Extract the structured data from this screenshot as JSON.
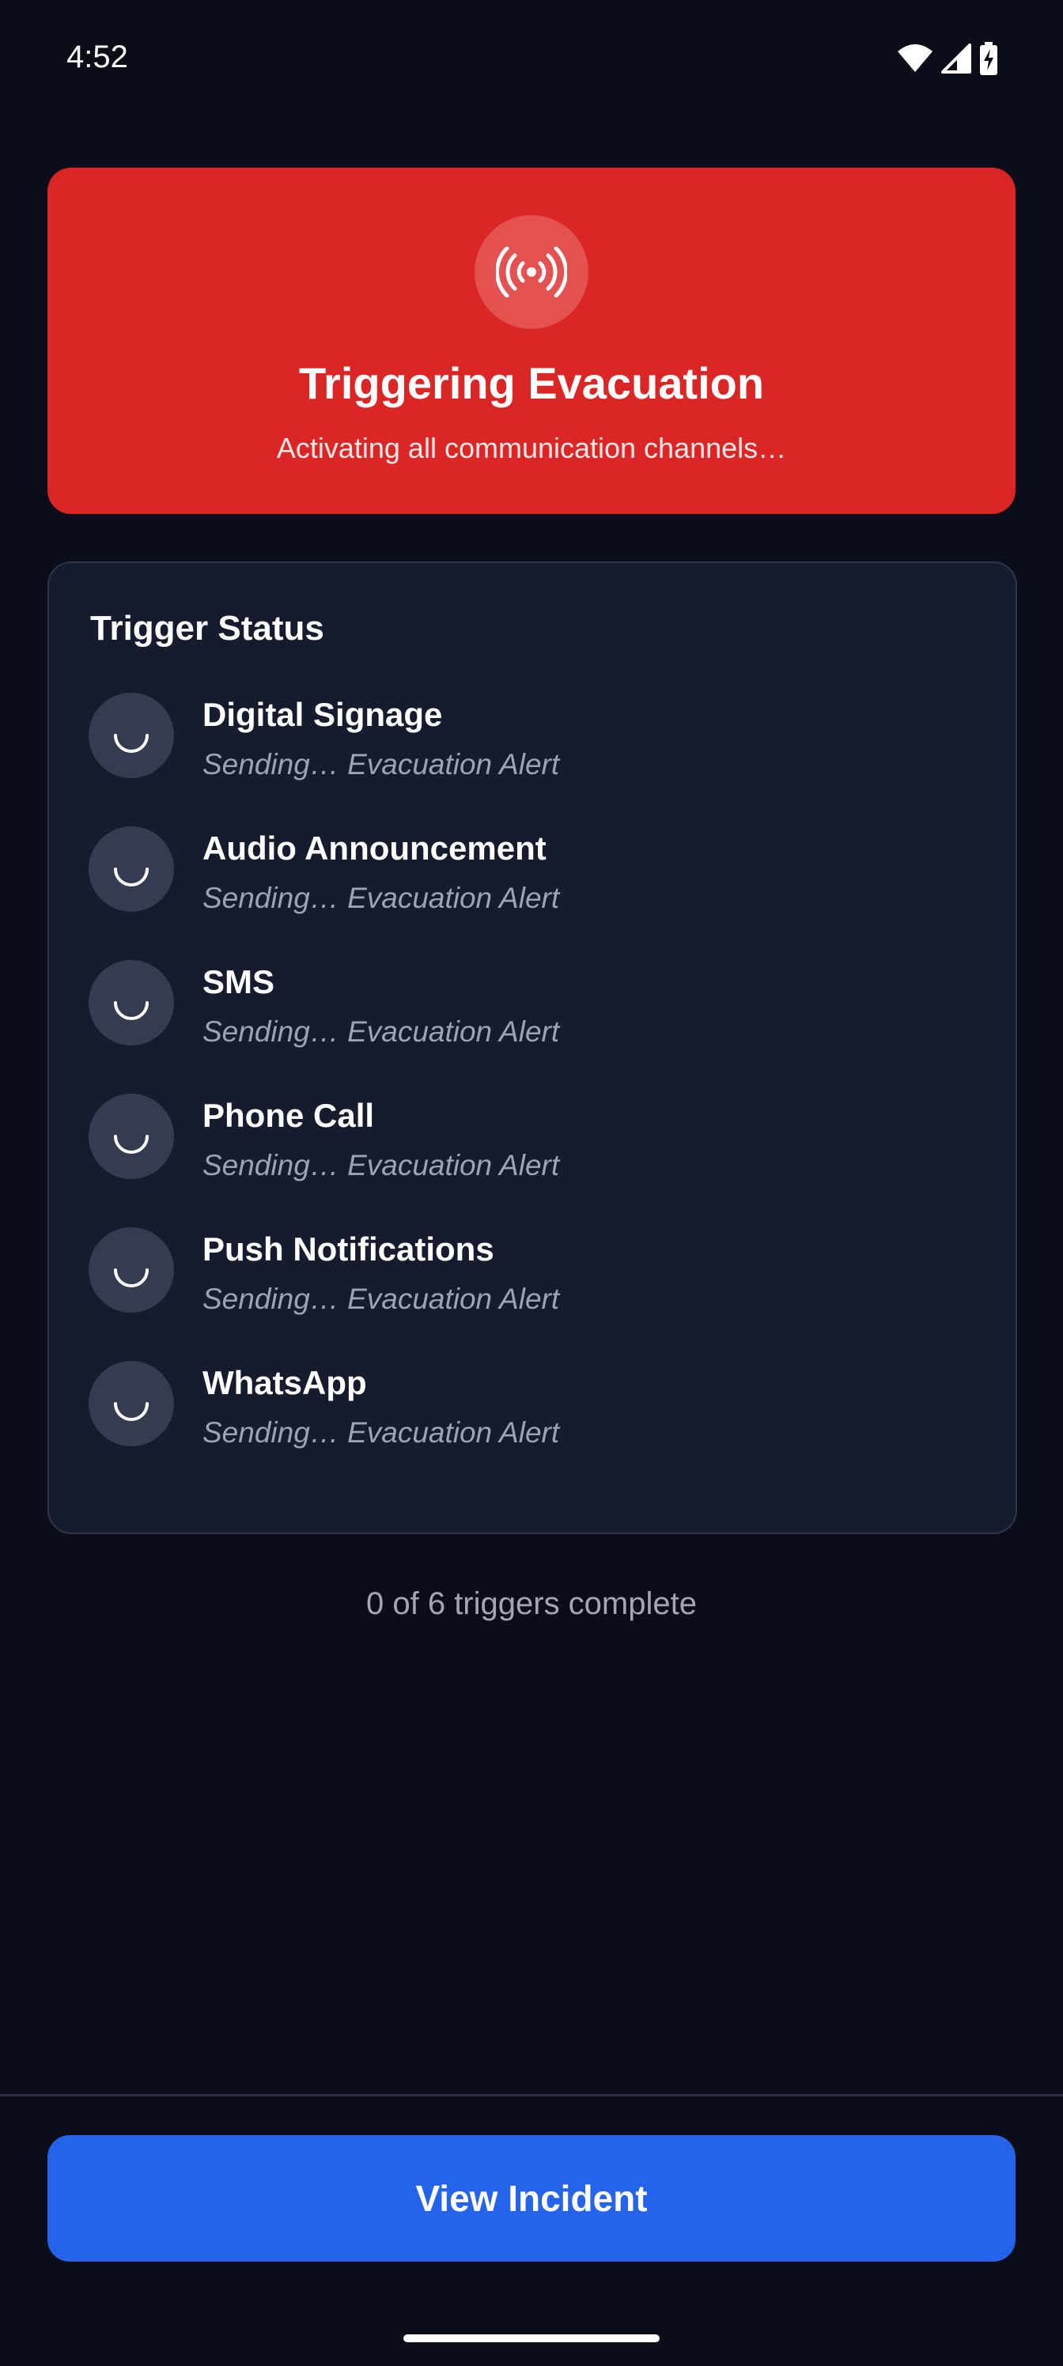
{
  "status_bar": {
    "time": "4:52",
    "icons": [
      "wifi-icon",
      "cellular-signal-icon",
      "battery-charging-icon"
    ]
  },
  "hero": {
    "icon": "broadcast-icon",
    "title": "Triggering Evacuation",
    "subtitle": "Activating all communication channels…",
    "background_color": "#dc2626"
  },
  "trigger_status": {
    "title": "Trigger Status",
    "items": [
      {
        "name": "Digital Signage",
        "status": "Sending… Evacuation Alert",
        "icon": "loading-spinner-icon"
      },
      {
        "name": "Audio Announcement",
        "status": "Sending… Evacuation Alert",
        "icon": "loading-spinner-icon"
      },
      {
        "name": "SMS",
        "status": "Sending… Evacuation Alert",
        "icon": "loading-spinner-icon"
      },
      {
        "name": "Phone Call",
        "status": "Sending… Evacuation Alert",
        "icon": "loading-spinner-icon"
      },
      {
        "name": "Push Notifications",
        "status": "Sending… Evacuation Alert",
        "icon": "loading-spinner-icon"
      },
      {
        "name": "WhatsApp",
        "status": "Sending… Evacuation Alert",
        "icon": "loading-spinner-icon"
      }
    ]
  },
  "progress": {
    "text": "0 of 6 triggers complete"
  },
  "actions": {
    "view_incident_label": "View Incident",
    "button_color": "#2563eb"
  }
}
